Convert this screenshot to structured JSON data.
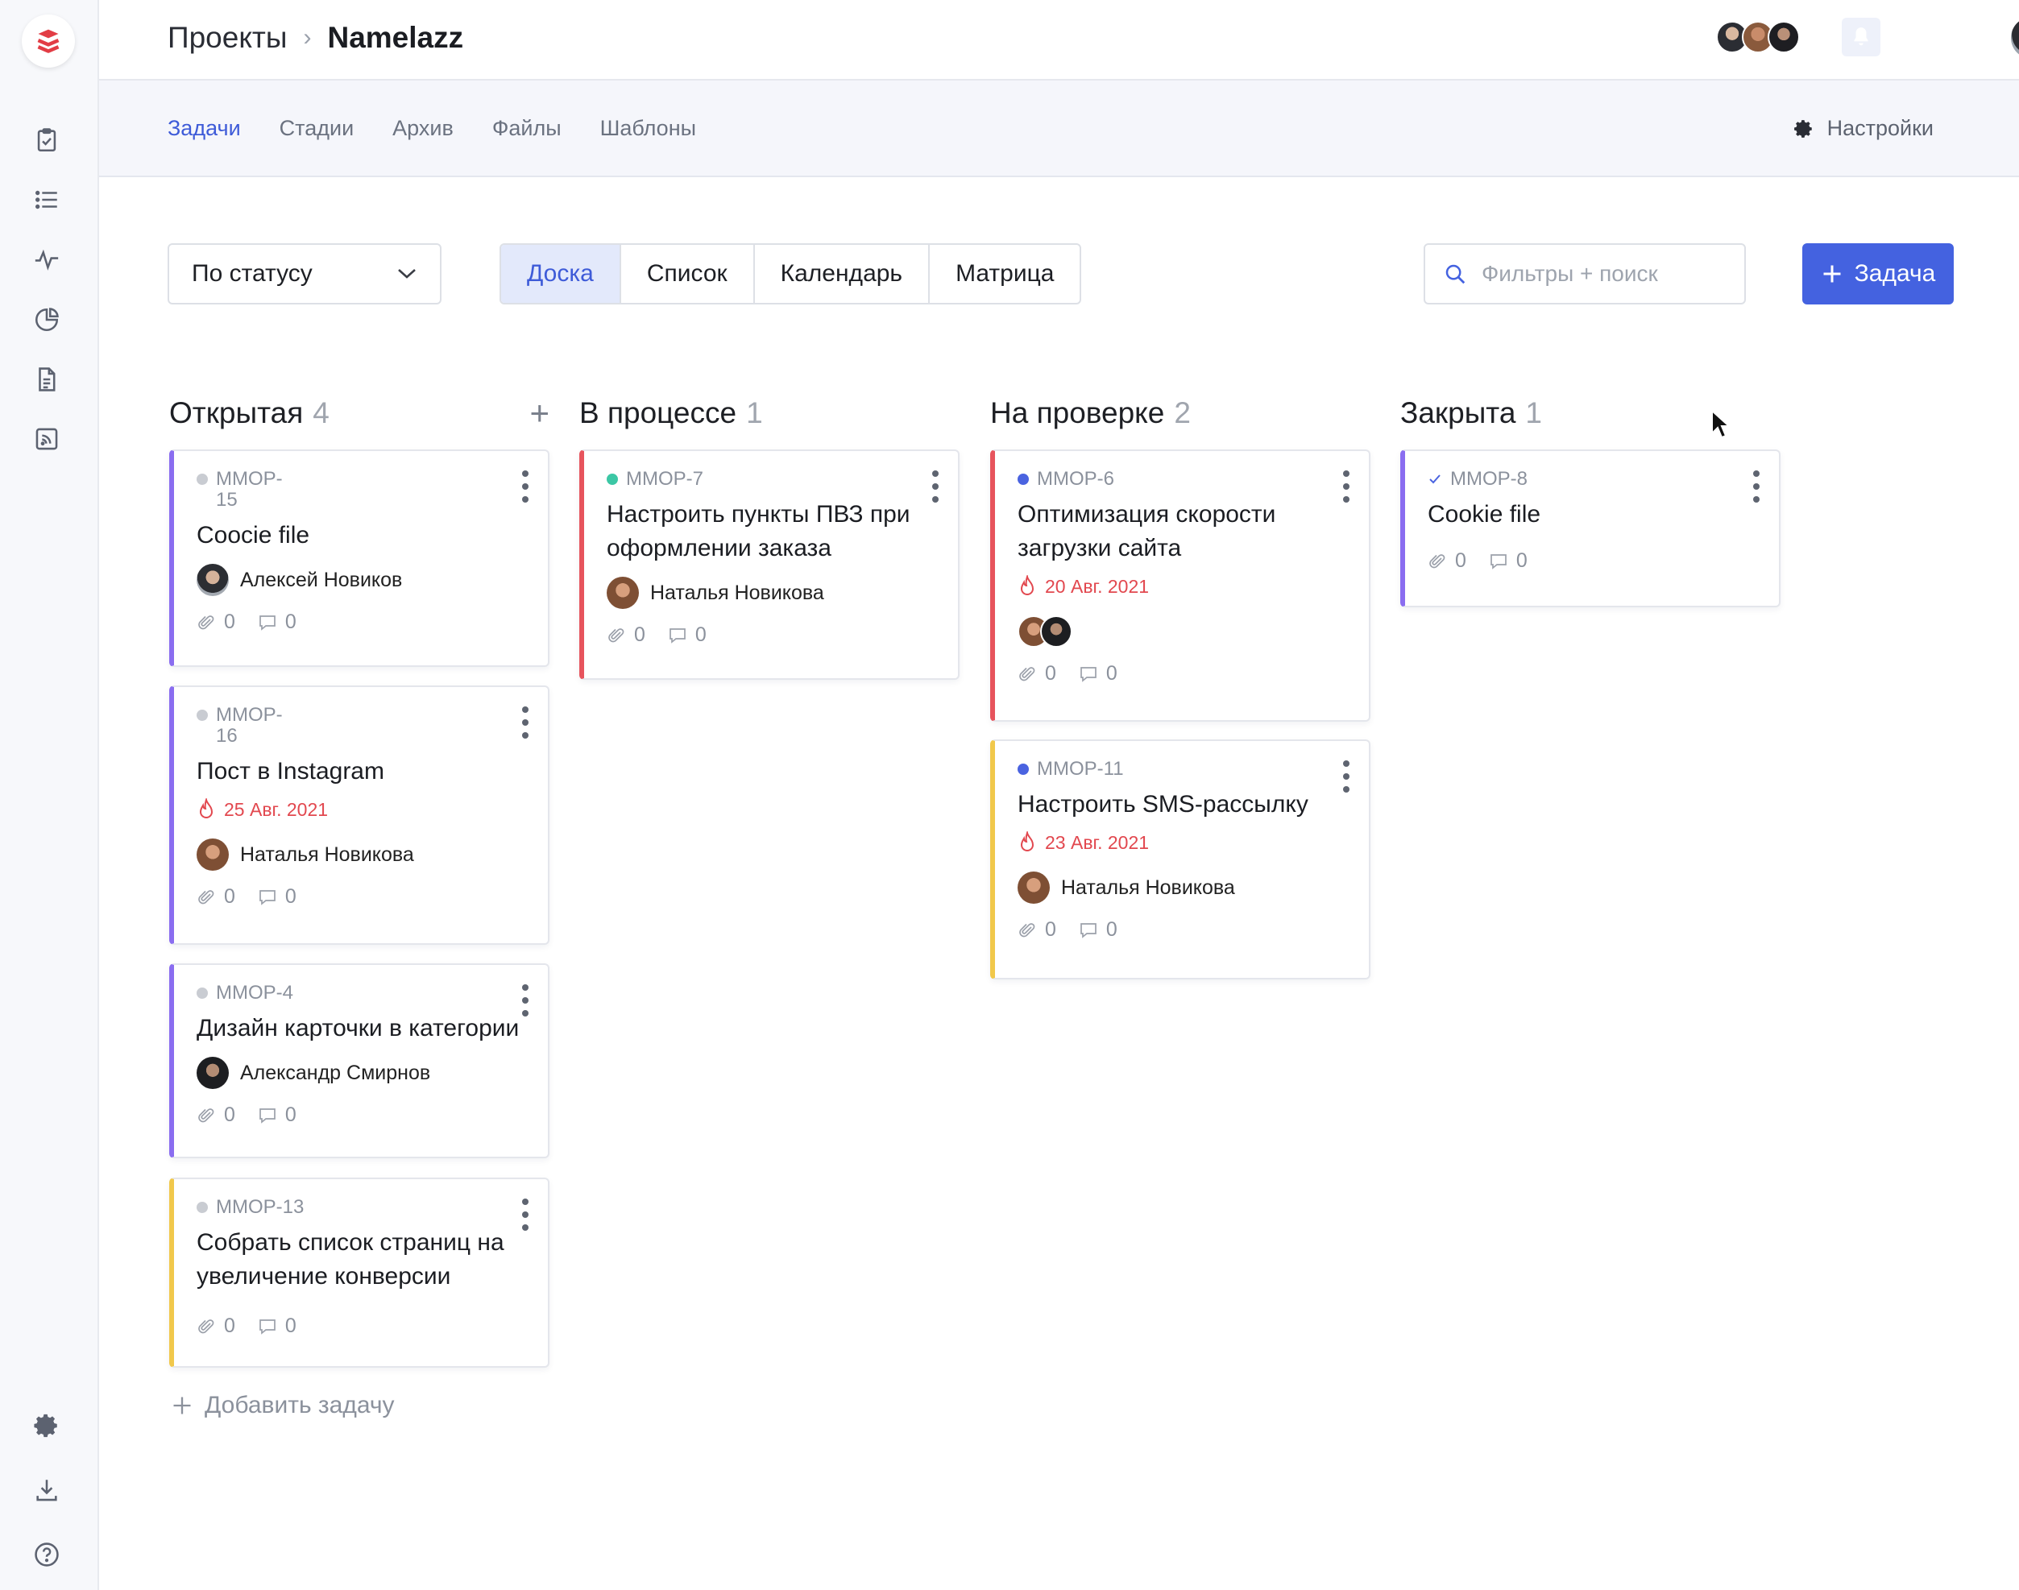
{
  "app": {
    "colors": {
      "accent": "#4462e0",
      "accent_text": "#3e5bd8",
      "danger": "#e2484f",
      "purple": "#8a6df0",
      "red": "#e7545d",
      "yellow": "#f1c84b"
    }
  },
  "rail": {
    "icons": [
      "tasks-icon",
      "list-icon",
      "activity-icon",
      "chart-icon",
      "document-icon",
      "feed-icon",
      "settings-icon",
      "download-icon",
      "help-icon"
    ]
  },
  "header": {
    "breadcrumb_root": "Проекты",
    "breadcrumb_current": "Namelazz"
  },
  "subnav": {
    "tabs": [
      {
        "label": "Задачи",
        "active": true
      },
      {
        "label": "Стадии",
        "active": false
      },
      {
        "label": "Архив",
        "active": false
      },
      {
        "label": "Файлы",
        "active": false
      },
      {
        "label": "Шаблоны",
        "active": false
      }
    ],
    "settings_label": "Настройки"
  },
  "toolbar": {
    "group_by": "По статусу",
    "views": [
      {
        "label": "Доска",
        "active": true
      },
      {
        "label": "Список",
        "active": false
      },
      {
        "label": "Календарь",
        "active": false
      },
      {
        "label": "Матрица",
        "active": false
      }
    ],
    "search_placeholder": "Фильтры + поиск",
    "add_task_label": "Задача"
  },
  "board": {
    "columns": [
      {
        "name": "Открытая",
        "count": "4",
        "cards": [
          {
            "code": "MMOP-15",
            "code_lines": [
              "MMOP-",
              "15"
            ],
            "status_dot": "grey",
            "title": "Coocie file",
            "assignee": "Алексей Новиков",
            "attachments": "0",
            "comments": "0",
            "color": "purple"
          },
          {
            "code": "MMOP-16",
            "code_lines": [
              "MMOP-",
              "16"
            ],
            "status_dot": "grey",
            "title": "Пост в Instagram",
            "due": "25 Авг. 2021",
            "assignee": "Наталья Новикова",
            "attachments": "0",
            "comments": "0",
            "color": "purple"
          },
          {
            "code": "MMOP-4",
            "status_dot": "grey",
            "title": "Дизайн карточки в категории",
            "assignee": "Александр Смирнов",
            "attachments": "0",
            "comments": "0",
            "color": "purple"
          },
          {
            "code": "MMOP-13",
            "status_dot": "grey",
            "title": "Собрать список страниц на увеличение конверсии",
            "attachments": "0",
            "comments": "0",
            "color": "yellow"
          }
        ],
        "add_label": "Добавить задачу"
      },
      {
        "name": "В процессе",
        "count": "1",
        "cards": [
          {
            "code": "MMOP-7",
            "status_dot": "teal",
            "title": "Настроить пункты ПВЗ при оформлении заказа",
            "assignee": "Наталья Новикова",
            "attachments": "0",
            "comments": "0",
            "color": "red"
          }
        ]
      },
      {
        "name": "На проверке",
        "count": "2",
        "cards": [
          {
            "code": "MMOP-6",
            "status_dot": "blue",
            "title": "Оптимизация скорости загрузки сайта",
            "due": "20 Авг. 2021",
            "attachments": "0",
            "comments": "0",
            "color": "red"
          },
          {
            "code": "MMOP-11",
            "status_dot": "blue",
            "title": "Настроить SMS-рассылку",
            "due": "23 Авг. 2021",
            "assignee": "Наталья Новикова",
            "attachments": "0",
            "comments": "0",
            "color": "yellow"
          }
        ]
      },
      {
        "name": "Закрыта",
        "count": "1",
        "cards": [
          {
            "code": "MMOP-8",
            "status_dot": "check",
            "title": "Cookie file",
            "attachments": "0",
            "comments": "0",
            "color": "purple"
          }
        ]
      }
    ]
  }
}
